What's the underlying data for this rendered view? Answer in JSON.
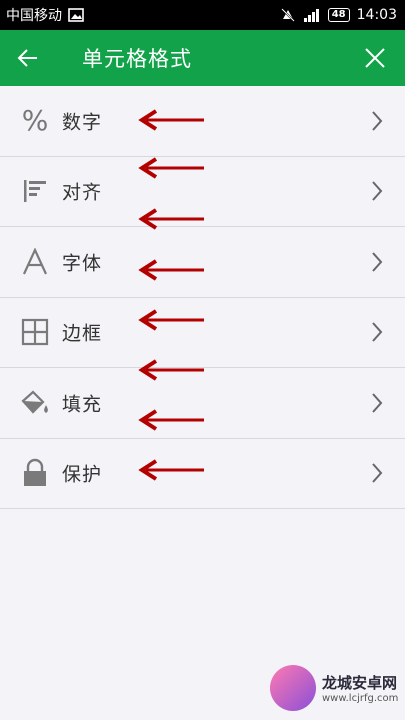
{
  "status": {
    "carrier": "中国移动",
    "battery": "48",
    "time": "14:03"
  },
  "header": {
    "title": "单元格格式",
    "back_icon": "arrow-left-icon",
    "close_icon": "close-icon"
  },
  "menu": [
    {
      "label": "数字",
      "icon": "percent-icon"
    },
    {
      "label": "对齐",
      "icon": "align-icon"
    },
    {
      "label": "字体",
      "icon": "font-icon"
    },
    {
      "label": "边框",
      "icon": "border-icon"
    },
    {
      "label": "填充",
      "icon": "fill-bucket-icon"
    },
    {
      "label": "保护",
      "icon": "lock-icon"
    }
  ],
  "colors": {
    "appbar": "#12a34a",
    "annotation_arrow": "#b30000"
  },
  "watermark": {
    "title": "龙城安卓网",
    "url": "www.lcjrfg.com"
  }
}
